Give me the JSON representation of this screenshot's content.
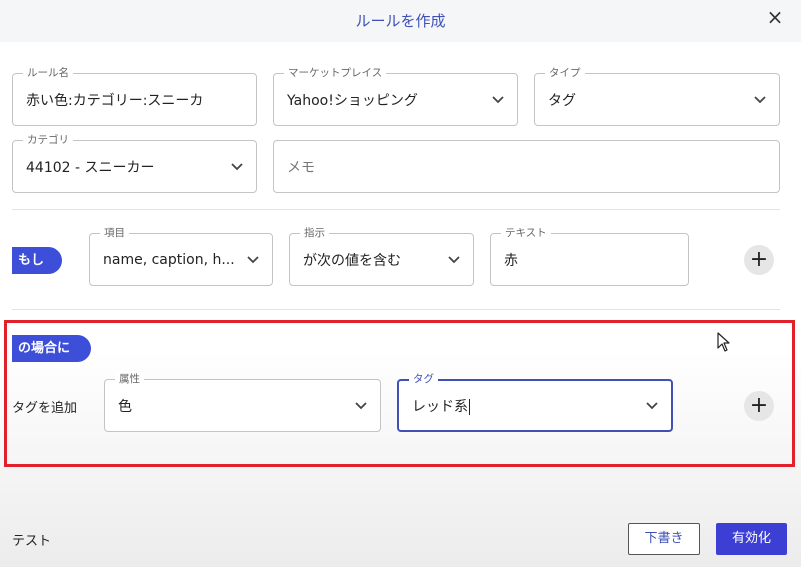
{
  "dialog": {
    "title": "ルールを作成",
    "close_icon": "×"
  },
  "rule": {
    "name_label": "ルール名",
    "name_value": "赤い色:カテゴリー:スニーカ",
    "marketplace_label": "マーケットプレイス",
    "marketplace_value": "Yahoo!ショッピング",
    "type_label": "タイプ",
    "type_value": "タグ",
    "category_label": "カテゴリ",
    "category_value": "44102 - スニーカー",
    "memo_placeholder": "メモ"
  },
  "condition": {
    "badge": "もし",
    "item_label": "項目",
    "item_value": "name, caption, h...",
    "operator_label": "指示",
    "operator_value": "が次の値を含む",
    "text_label": "テキスト",
    "text_value": "赤",
    "add_icon": "+"
  },
  "action": {
    "badge": "の場合に",
    "action_label": "タグを追加",
    "attribute_label": "属性",
    "attribute_value": "色",
    "tag_label": "タグ",
    "tag_value": "レッド系",
    "add_icon": "+"
  },
  "footer": {
    "test_label": "テスト",
    "draft_button": "下書き",
    "enable_button": "有効化"
  },
  "colors": {
    "accent": "#3d4ed8",
    "highlight_border": "#e0202a",
    "title_color": "#3f51b5"
  }
}
